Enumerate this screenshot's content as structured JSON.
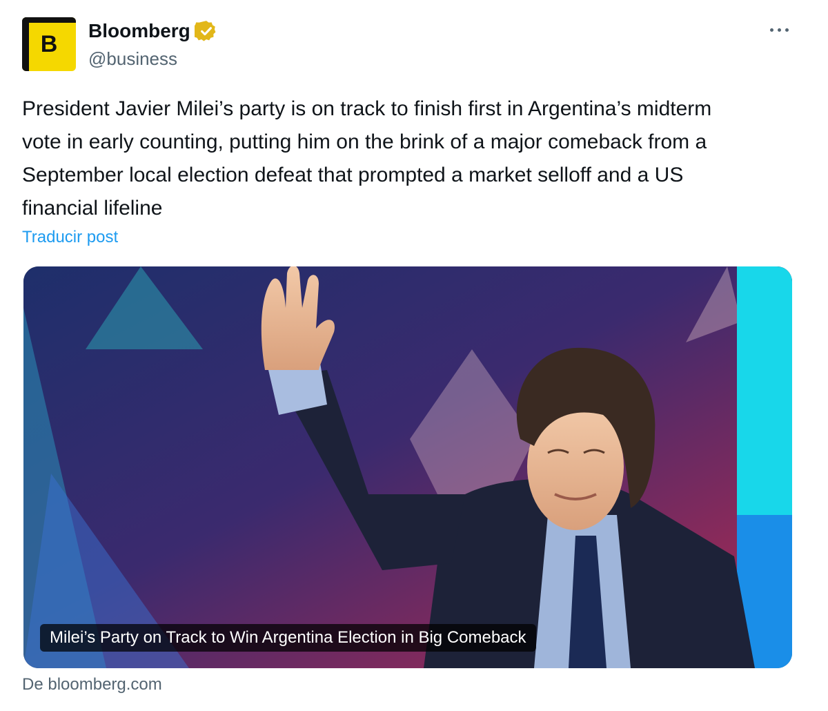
{
  "author": {
    "display_name": "Bloomberg",
    "handle": "@business",
    "avatar_letter": "B",
    "verified_icon": "verified-gold-badge-icon"
  },
  "more_icon": "more-options-icon",
  "tweet": {
    "text": "President Javier Milei’s party is on track to finish first in Argentina’s midterm vote in early counting, putting him on the brink of a major comeback from a September local election defeat that prompted a market selloff and a US financial lifeline",
    "translate_label": "Traducir post"
  },
  "card": {
    "title": "Milei’s Party on Track to Win Argentina Election in Big Comeback",
    "source": "De bloomberg.com"
  },
  "colors": {
    "link": "#1d9bf0",
    "secondary_text": "#536471",
    "avatar_bg": "#f5d800",
    "verified_gold": "#e2b719"
  }
}
